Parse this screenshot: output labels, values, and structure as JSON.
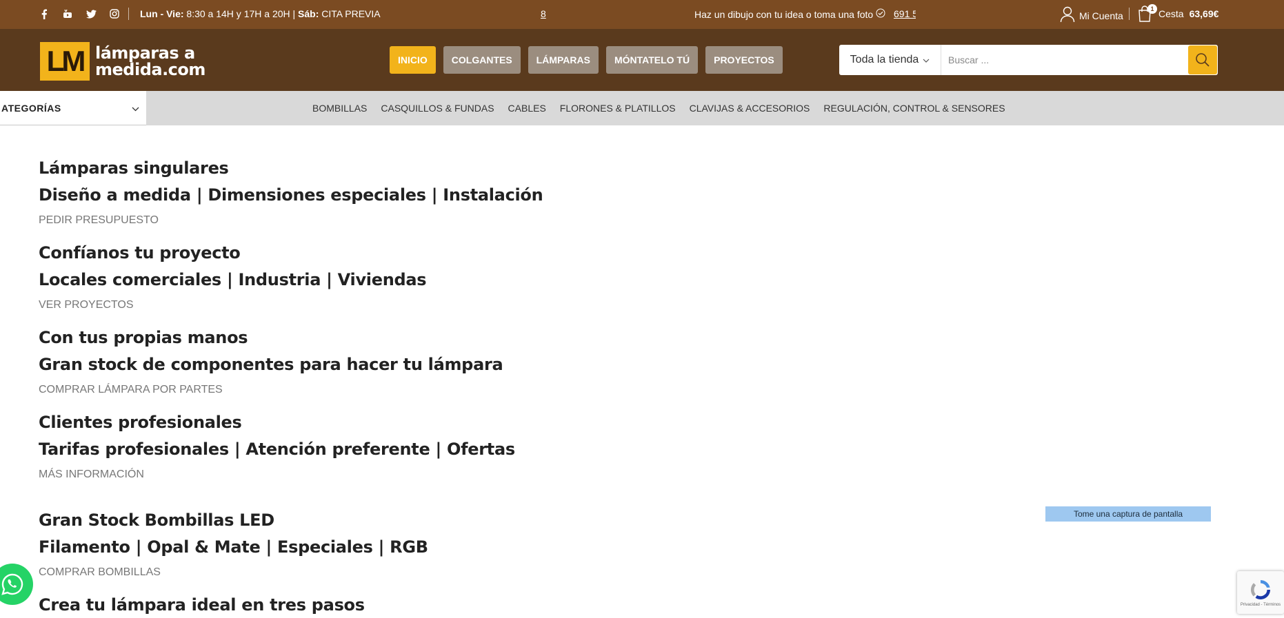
{
  "topbar": {
    "social_icons": [
      "facebook-icon",
      "youtube-icon",
      "twitter-icon",
      "instagram-icon"
    ],
    "hours_label": "Lun - Vie:",
    "hours_value": " 8:30 a 14H y 17H a 20H | ",
    "saturday_label": "Sáb:",
    "saturday_value": " CITA PREVIA",
    "marquee_number": "8",
    "promo_text": "Haz un dibujo con tu idea o toma una foto",
    "phone": "691 5",
    "account_label": "Mi Cuenta",
    "cart_count": "1",
    "cart_label": "Cesta",
    "cart_total": "63,69€"
  },
  "header": {
    "logo_mark": "LM",
    "logo_line1": "lámparas a",
    "logo_line2": "medida.com",
    "nav": [
      "INICIO",
      "COLGANTES",
      "LÁMPARAS",
      "MÓNTATELO TÚ",
      "PROYECTOS"
    ],
    "search_scope": "Toda la tienda",
    "search_placeholder": "Buscar ..."
  },
  "catbar": {
    "select_label": "ATEGORÍAS",
    "links": [
      "BOMBILLAS",
      "CASQUILLOS & FUNDAS",
      "CABLES",
      "FLORONES & PLATILLOS",
      "CLAVIJAS & ACCESORIOS",
      "REGULACIÓN, CONTROL & SENSORES"
    ]
  },
  "blocks": [
    {
      "title": "Lámparas singulares",
      "subtitle": "Diseño a medida | Dimensiones especiales | Instalación",
      "link": "PEDIR PRESUPUESTO"
    },
    {
      "title": "Confíanos tu proyecto",
      "subtitle": "Locales comerciales | Industria | Viviendas",
      "link": "VER PROYECTOS"
    },
    {
      "title": "Con tus propias manos",
      "subtitle": "Gran stock de componentes para hacer tu lámpara",
      "link": "COMPRAR LÁMPARA POR PARTES"
    },
    {
      "title": "Clientes profesionales",
      "subtitle": "Tarifas profesionales | Atención preferente | Ofertas",
      "link": "MÁS INFORMACIÓN"
    },
    {
      "title": "Gran Stock Bombillas LED",
      "subtitle": "Filamento | Opal & Mate | Especiales | RGB",
      "link": "COMPRAR BOMBILLAS"
    },
    {
      "title": "Crea tu lámpara ideal en tres pasos",
      "subtitle": "",
      "link": ""
    }
  ],
  "overlay": {
    "screenshot_button": "Tome una captura de pantalla",
    "recaptcha_text": "Privacidad - Términos"
  },
  "colors": {
    "topbar": "#7b4b22",
    "header": "#5a3a1d",
    "accent": "#f2b31b",
    "nav_button": "#9b8d7f"
  }
}
